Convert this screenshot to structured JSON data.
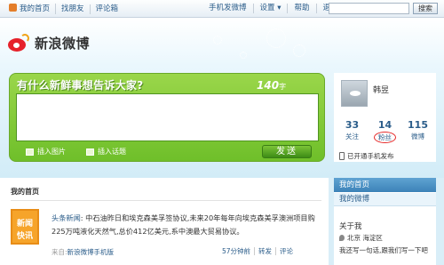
{
  "topbar": {
    "nav": [
      "我的首页",
      "找朋友",
      "评论箱"
    ],
    "right": [
      "手机发微博",
      "设置 ▾",
      "帮助",
      "退出"
    ],
    "search_label": "搜索"
  },
  "logo": {
    "text": "新浪微博"
  },
  "composer": {
    "prompt": "有什么新鲜事想告诉大家?",
    "count": "140",
    "count_unit": "字",
    "tools": [
      "插入图片",
      "插入话题"
    ],
    "send_label": "发送"
  },
  "profile": {
    "name": "韩昱",
    "stats": [
      {
        "value": "33",
        "label": "关注"
      },
      {
        "value": "14",
        "label": "粉丝"
      },
      {
        "value": "115",
        "label": "微博"
      }
    ],
    "phone_text": "已开通手机发布"
  },
  "feed": {
    "title": "我的首页",
    "avatar_lines": [
      "新闻",
      "快讯"
    ],
    "post": {
      "author": "头条新闻",
      "text": ": 中石油昨日和埃克森美孚签协议,未来20年每年向埃克森美孚澳洲项目购225万吨液化天然气,总价412亿美元,系中澳最大贸易协议。",
      "source_prefix": "来自:",
      "source": "新浪微博手机版",
      "actions": [
        "57分钟前",
        "转发",
        "评论"
      ]
    }
  },
  "sidebar": {
    "tabs": [
      "我的首页",
      "我的微博"
    ],
    "about_title": "关于我",
    "location": "北京 海淀区",
    "bio": "我还写一句话,跟我们写一下吧"
  }
}
